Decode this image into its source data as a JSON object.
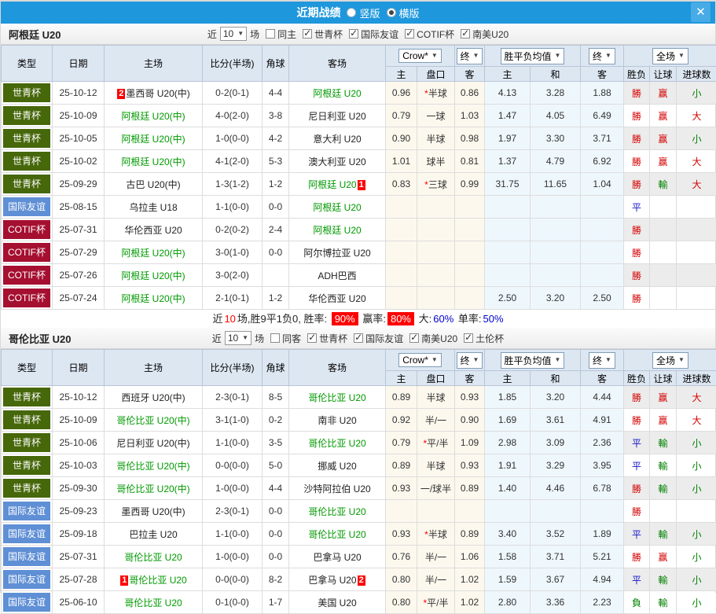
{
  "colors": {
    "titlebar_blue": "#1e97dc",
    "close_btn_blue": "#47abe6",
    "badge_wc": "#46670a",
    "badge_fr": "#5f8fd5",
    "badge_co": "#a50f30",
    "team_green": "#009900",
    "score_red": "#e60000",
    "win_red": "#d40000",
    "draw_blue": "#1414cc",
    "lose_green": "#008000",
    "pct_bg_red": "#ff0000",
    "rate_blue": "#0000d0",
    "header_bg": "#dde7f2",
    "crow_col_bg": "#fdf8ee",
    "avg_col_bg": "#eef7fc"
  },
  "ui": {
    "caret": "▼",
    "near": "近",
    "games": "场"
  },
  "titlebar": {
    "title": "近期战绩",
    "radios": [
      {
        "label": "竖版",
        "selected": false
      },
      {
        "label": "横版",
        "selected": true
      }
    ],
    "close_label": "✕"
  },
  "table_header": {
    "type": "类型",
    "date": "日期",
    "home": "主场",
    "score": "比分(半场)",
    "corner": "角球",
    "away": "客场",
    "crow_select": "Crow*",
    "final_select": "终",
    "avg_select": "胜平负均值",
    "final_select2": "终",
    "fulltime_select": "全场",
    "sub": [
      "主",
      "盘口",
      "客",
      "主",
      "和",
      "客",
      "胜负",
      "让球",
      "进球数"
    ]
  },
  "sections": [
    {
      "team": "阿根廷 U20",
      "filters": {
        "count": "10",
        "same_label": "同主",
        "same_checked": false,
        "comps": [
          {
            "label": "世青杯",
            "checked": true
          },
          {
            "label": "国际友谊",
            "checked": true
          },
          {
            "label": "COTIF杯",
            "checked": true
          },
          {
            "label": "南美U20",
            "checked": true
          }
        ]
      },
      "rows": [
        {
          "type": "世青杯",
          "k": "wc",
          "date": "25-10-12",
          "home": {
            "badge": "2",
            "name": "墨西哥 U20(中)",
            "green": false
          },
          "score": "0-2(0-1)",
          "corner": "4-4",
          "away": {
            "name": "阿根廷 U20",
            "green": true
          },
          "crow": {
            "h": "0.96",
            "star": "*",
            "line": "半球",
            "a": "0.86"
          },
          "avg": [
            "4.13",
            "3.28",
            "1.88"
          ],
          "res": [
            "勝",
            "赢",
            "小"
          ]
        },
        {
          "type": "世青杯",
          "k": "wc",
          "date": "25-10-09",
          "home": {
            "name": "阿根廷 U20(中)",
            "green": true
          },
          "score": "4-0(2-0)",
          "corner": "3-8",
          "away": {
            "name": "尼日利亚 U20",
            "green": false
          },
          "crow": {
            "h": "0.79",
            "star": "",
            "line": "一球",
            "a": "1.03"
          },
          "avg": [
            "1.47",
            "4.05",
            "6.49"
          ],
          "res": [
            "勝",
            "赢",
            "大"
          ]
        },
        {
          "type": "世青杯",
          "k": "wc",
          "date": "25-10-05",
          "home": {
            "name": "阿根廷 U20(中)",
            "green": true
          },
          "score": "1-0(0-0)",
          "corner": "4-2",
          "away": {
            "name": "意大利 U20",
            "green": false
          },
          "crow": {
            "h": "0.90",
            "star": "",
            "line": "半球",
            "a": "0.98"
          },
          "avg": [
            "1.97",
            "3.30",
            "3.71"
          ],
          "res": [
            "勝",
            "赢",
            "小"
          ]
        },
        {
          "type": "世青杯",
          "k": "wc",
          "date": "25-10-02",
          "home": {
            "name": "阿根廷 U20(中)",
            "green": true
          },
          "score": "4-1(2-0)",
          "corner": "5-3",
          "away": {
            "name": "澳大利亚 U20",
            "green": false
          },
          "crow": {
            "h": "1.01",
            "star": "",
            "line": "球半",
            "a": "0.81"
          },
          "avg": [
            "1.37",
            "4.79",
            "6.92"
          ],
          "res": [
            "勝",
            "赢",
            "大"
          ]
        },
        {
          "type": "世青杯",
          "k": "wc",
          "date": "25-09-29",
          "home": {
            "name": "古巴 U20(中)",
            "green": false
          },
          "score": "1-3(1-2)",
          "corner": "1-2",
          "away": {
            "name": "阿根廷 U20",
            "green": true,
            "badge_after": "1"
          },
          "crow": {
            "h": "0.83",
            "star": "*",
            "line": "三球",
            "a": "0.99"
          },
          "avg": [
            "31.75",
            "11.65",
            "1.04"
          ],
          "res": [
            "勝",
            "輸",
            "大"
          ]
        },
        {
          "type": "国际友谊",
          "k": "fr",
          "date": "25-08-15",
          "home": {
            "name": "乌拉圭 U18",
            "green": false
          },
          "score": "1-1(0-0)",
          "corner": "0-0",
          "away": {
            "name": "阿根廷 U20",
            "green": true
          },
          "crow": {
            "h": "",
            "star": "",
            "line": "",
            "a": ""
          },
          "avg": [
            "",
            "",
            ""
          ],
          "res": [
            "平",
            "",
            ""
          ]
        },
        {
          "type": "COTIF杯",
          "k": "co",
          "date": "25-07-31",
          "home": {
            "name": "华伦西亚 U20",
            "green": false
          },
          "score": "0-2(0-2)",
          "corner": "2-4",
          "away": {
            "name": "阿根廷 U20",
            "green": true
          },
          "crow": {
            "h": "",
            "star": "",
            "line": "",
            "a": ""
          },
          "avg": [
            "",
            "",
            ""
          ],
          "res": [
            "勝",
            "",
            ""
          ]
        },
        {
          "type": "COTIF杯",
          "k": "co",
          "date": "25-07-29",
          "home": {
            "name": "阿根廷 U20(中)",
            "green": true
          },
          "score": "3-0(1-0)",
          "corner": "0-0",
          "away": {
            "name": "阿尔博拉亚 U20",
            "green": false
          },
          "crow": {
            "h": "",
            "star": "",
            "line": "",
            "a": ""
          },
          "avg": [
            "",
            "",
            ""
          ],
          "res": [
            "勝",
            "",
            ""
          ]
        },
        {
          "type": "COTIF杯",
          "k": "co",
          "date": "25-07-26",
          "home": {
            "name": "阿根廷 U20(中)",
            "green": true
          },
          "score": "3-0(2-0)",
          "corner": "",
          "away": {
            "name": "ADH巴西",
            "green": false
          },
          "crow": {
            "h": "",
            "star": "",
            "line": "",
            "a": ""
          },
          "avg": [
            "",
            "",
            ""
          ],
          "res": [
            "勝",
            "",
            ""
          ]
        },
        {
          "type": "COTIF杯",
          "k": "co",
          "date": "25-07-24",
          "home": {
            "name": "阿根廷 U20(中)",
            "green": true
          },
          "score": "2-1(0-1)",
          "corner": "1-2",
          "away": {
            "name": "华伦西亚 U20",
            "green": false
          },
          "crow": {
            "h": "",
            "star": "",
            "line": "",
            "a": ""
          },
          "avg": [
            "2.50",
            "3.20",
            "2.50"
          ],
          "res": [
            "勝",
            "",
            ""
          ]
        }
      ],
      "summary": {
        "near": "近",
        "count": "10",
        "rest": "场,胜9平1负0, 胜率:",
        "pct1": "90%",
        "lbl2": "赢率:",
        "pct2": "80%",
        "lbl3": "大:",
        "v3": "60%",
        "lbl4": "单率:",
        "v4": "50%"
      }
    },
    {
      "team": "哥伦比亚 U20",
      "filters": {
        "count": "10",
        "same_label": "同客",
        "same_checked": false,
        "comps": [
          {
            "label": "世青杯",
            "checked": true
          },
          {
            "label": "国际友谊",
            "checked": true
          },
          {
            "label": "南美U20",
            "checked": true
          },
          {
            "label": "土伦杯",
            "checked": true
          }
        ]
      },
      "rows": [
        {
          "type": "世青杯",
          "k": "wc",
          "date": "25-10-12",
          "home": {
            "name": "西班牙 U20(中)",
            "green": false
          },
          "score": "2-3(0-1)",
          "corner": "8-5",
          "away": {
            "name": "哥伦比亚 U20",
            "green": true
          },
          "crow": {
            "h": "0.89",
            "star": "",
            "line": "半球",
            "a": "0.93"
          },
          "avg": [
            "1.85",
            "3.20",
            "4.44"
          ],
          "res": [
            "勝",
            "赢",
            "大"
          ]
        },
        {
          "type": "世青杯",
          "k": "wc",
          "date": "25-10-09",
          "home": {
            "name": "哥伦比亚 U20(中)",
            "green": true
          },
          "score": "3-1(1-0)",
          "corner": "0-2",
          "away": {
            "name": "南非 U20",
            "green": false
          },
          "crow": {
            "h": "0.92",
            "star": "",
            "line": "半/一",
            "a": "0.90"
          },
          "avg": [
            "1.69",
            "3.61",
            "4.91"
          ],
          "res": [
            "勝",
            "赢",
            "大"
          ]
        },
        {
          "type": "世青杯",
          "k": "wc",
          "date": "25-10-06",
          "home": {
            "name": "尼日利亚 U20(中)",
            "green": false
          },
          "score": "1-1(0-0)",
          "corner": "3-5",
          "away": {
            "name": "哥伦比亚 U20",
            "green": true
          },
          "crow": {
            "h": "0.79",
            "star": "*",
            "line": "平/半",
            "a": "1.09"
          },
          "avg": [
            "2.98",
            "3.09",
            "2.36"
          ],
          "res": [
            "平",
            "輸",
            "小"
          ]
        },
        {
          "type": "世青杯",
          "k": "wc",
          "date": "25-10-03",
          "home": {
            "name": "哥伦比亚 U20(中)",
            "green": true
          },
          "score": "0-0(0-0)",
          "corner": "5-0",
          "away": {
            "name": "挪威 U20",
            "green": false
          },
          "crow": {
            "h": "0.89",
            "star": "",
            "line": "半球",
            "a": "0.93"
          },
          "avg": [
            "1.91",
            "3.29",
            "3.95"
          ],
          "res": [
            "平",
            "輸",
            "小"
          ]
        },
        {
          "type": "世青杯",
          "k": "wc",
          "date": "25-09-30",
          "home": {
            "name": "哥伦比亚 U20(中)",
            "green": true
          },
          "score": "1-0(0-0)",
          "corner": "4-4",
          "away": {
            "name": "沙特阿拉伯 U20",
            "green": false
          },
          "crow": {
            "h": "0.93",
            "star": "",
            "line": "一/球半",
            "a": "0.89"
          },
          "avg": [
            "1.40",
            "4.46",
            "6.78"
          ],
          "res": [
            "勝",
            "輸",
            "小"
          ]
        },
        {
          "type": "国际友谊",
          "k": "fr",
          "date": "25-09-23",
          "home": {
            "name": "墨西哥 U20(中)",
            "green": false
          },
          "score": "2-3(0-1)",
          "corner": "0-0",
          "away": {
            "name": "哥伦比亚 U20",
            "green": true
          },
          "crow": {
            "h": "",
            "star": "",
            "line": "",
            "a": ""
          },
          "avg": [
            "",
            "",
            ""
          ],
          "res": [
            "勝",
            "",
            ""
          ]
        },
        {
          "type": "国际友谊",
          "k": "fr",
          "date": "25-09-18",
          "home": {
            "name": "巴拉圭 U20",
            "green": false
          },
          "score": "1-1(0-0)",
          "corner": "0-0",
          "away": {
            "name": "哥伦比亚 U20",
            "green": true
          },
          "crow": {
            "h": "0.93",
            "star": "*",
            "line": "半球",
            "a": "0.89"
          },
          "avg": [
            "3.40",
            "3.52",
            "1.89"
          ],
          "res": [
            "平",
            "輸",
            "小"
          ]
        },
        {
          "type": "国际友谊",
          "k": "fr",
          "date": "25-07-31",
          "home": {
            "name": "哥伦比亚 U20",
            "green": true
          },
          "score": "1-0(0-0)",
          "corner": "0-0",
          "away": {
            "name": "巴拿马 U20",
            "green": false
          },
          "crow": {
            "h": "0.76",
            "star": "",
            "line": "半/一",
            "a": "1.06"
          },
          "avg": [
            "1.58",
            "3.71",
            "5.21"
          ],
          "res": [
            "勝",
            "赢",
            "小"
          ]
        },
        {
          "type": "国际友谊",
          "k": "fr",
          "date": "25-07-28",
          "home": {
            "badge": "1",
            "name": "哥伦比亚 U20",
            "green": true
          },
          "score": "0-0(0-0)",
          "corner": "8-2",
          "away": {
            "name": "巴拿马 U20",
            "green": false,
            "badge_after": "2"
          },
          "crow": {
            "h": "0.80",
            "star": "",
            "line": "半/一",
            "a": "1.02"
          },
          "avg": [
            "1.59",
            "3.67",
            "4.94"
          ],
          "res": [
            "平",
            "輸",
            "小"
          ]
        },
        {
          "type": "国际友谊",
          "k": "fr",
          "date": "25-06-10",
          "home": {
            "name": "哥伦比亚 U20",
            "green": true
          },
          "score": "0-1(0-0)",
          "corner": "1-7",
          "away": {
            "name": "美国 U20",
            "green": false
          },
          "crow": {
            "h": "0.80",
            "star": "*",
            "line": "平/半",
            "a": "1.02"
          },
          "avg": [
            "2.80",
            "3.36",
            "2.23"
          ],
          "res": [
            "負",
            "輸",
            "小"
          ]
        }
      ]
    }
  ]
}
